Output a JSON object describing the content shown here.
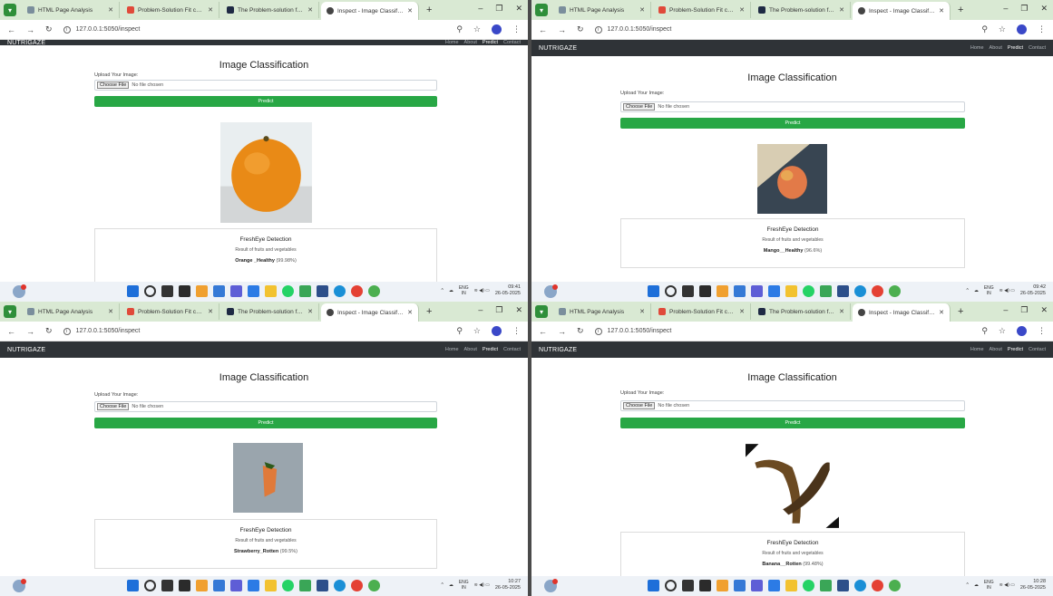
{
  "common": {
    "tabs": [
      "HTML Page Analysis",
      "Problem-Solution Fit canvas —",
      "The Problem-solution fit canvas",
      "Inspect - Image Classification"
    ],
    "url": "127.0.0.1:5050/inspect",
    "brand": "NUTRIGAZE",
    "nav": [
      "Home",
      "About",
      "Predict",
      "Contact"
    ],
    "page_title": "Image Classification",
    "upload_label": "Upload Your Image:",
    "choose_file": "Choose File",
    "no_file": "No file chosen",
    "predict_button": "Predict",
    "card_title": "FreshEye Detection",
    "card_subtitle": "Result of fruits and vegetables",
    "tray_lang": "ENG",
    "tray_region": "IN",
    "date": "26-05-2025"
  },
  "windows": [
    {
      "result_name": "Orange _Healthy",
      "result_conf": "(99.98%)",
      "time": "09:41",
      "photo": "orange"
    },
    {
      "result_name": "Mango__Healthy",
      "result_conf": "(96.6%)",
      "time": "09:42",
      "photo": "mango"
    },
    {
      "result_name": "Strawberry_Rotten",
      "result_conf": "(99.5%)",
      "time": "10:27",
      "photo": "strawberry"
    },
    {
      "result_name": "Banana__Rotten",
      "result_conf": "(99.48%)",
      "time": "10:28",
      "photo": "banana"
    }
  ],
  "colors": {
    "predict": "#28a745",
    "navbar": "#2f3337",
    "tabbar": "#d9e9d3",
    "taskbar": "#eef2f7"
  }
}
